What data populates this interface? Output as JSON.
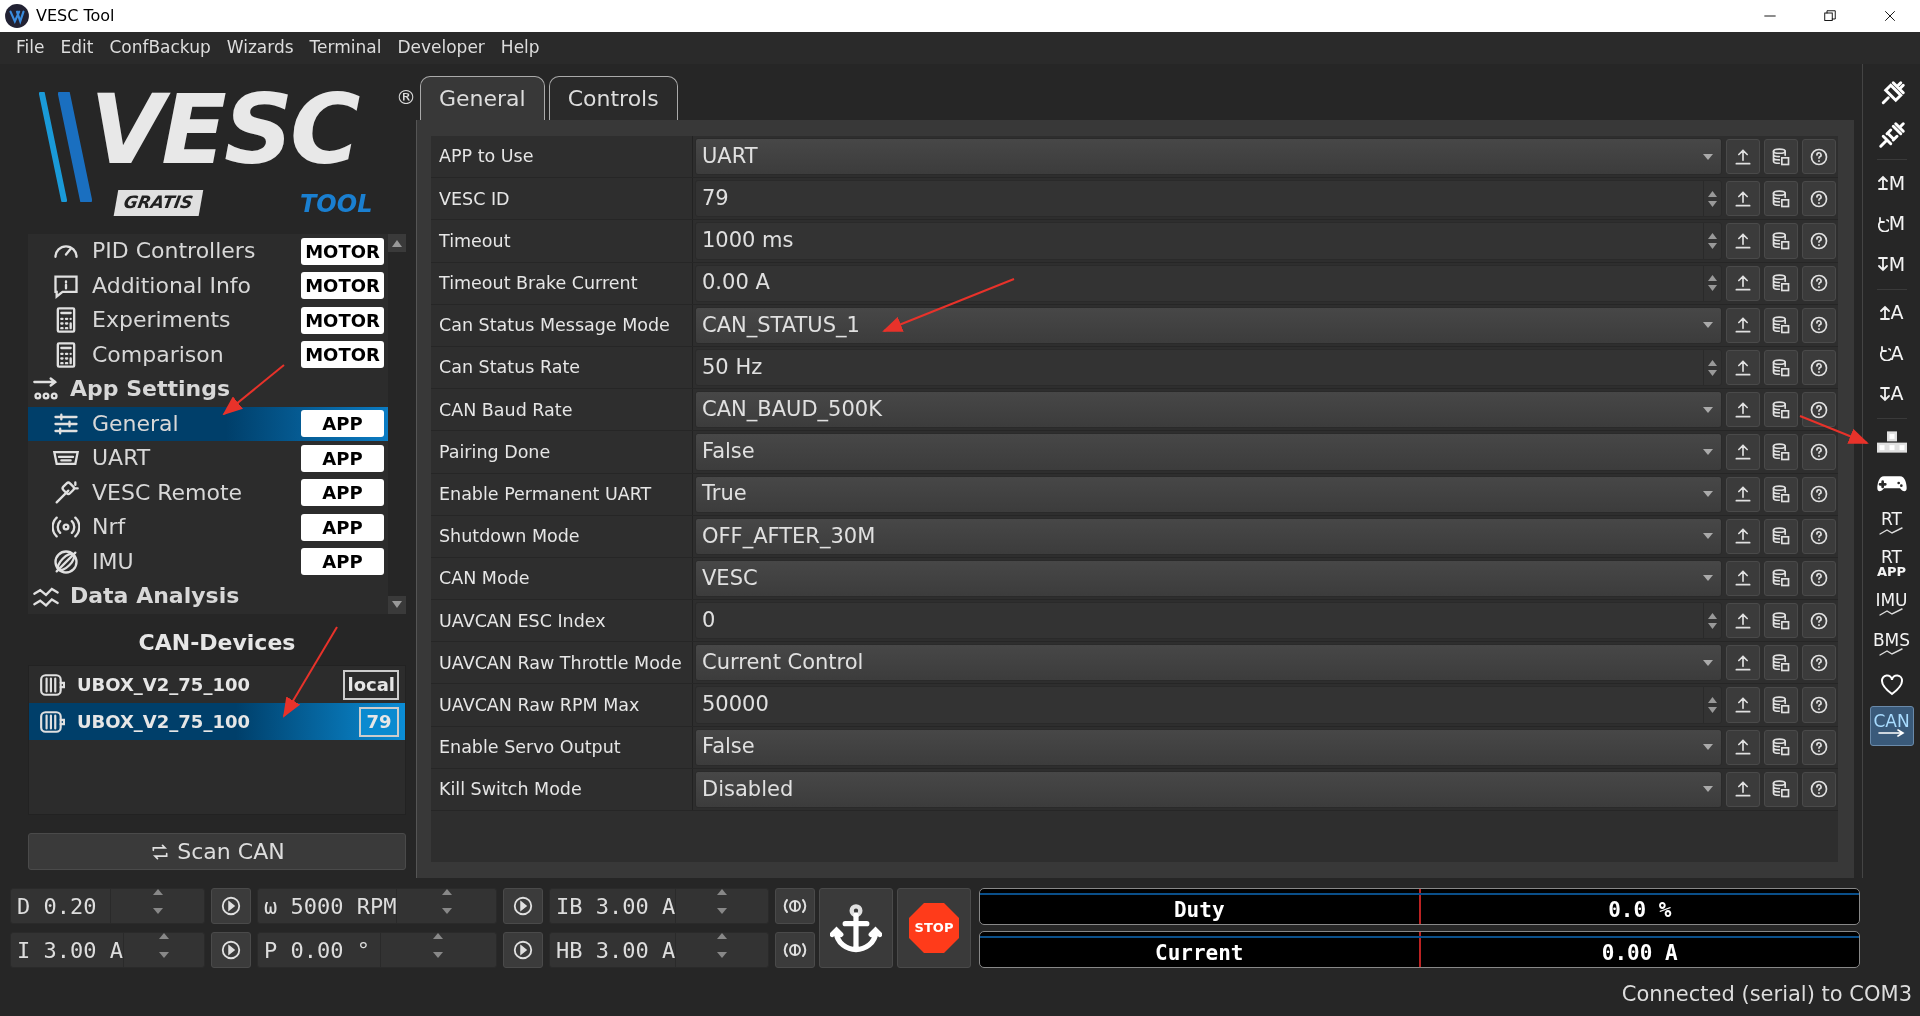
{
  "window": {
    "title": "VESC Tool"
  },
  "menu": [
    "File",
    "Edit",
    "ConfBackup",
    "Wizards",
    "Terminal",
    "Developer",
    "Help"
  ],
  "logo": {
    "wordmark": "VESC",
    "mark": "®",
    "badge": "GRATIS",
    "subtitle": "TOOL"
  },
  "sidebar": {
    "items": [
      {
        "kind": "item",
        "label": "PID Controllers",
        "tag": "MOTOR",
        "selected": false
      },
      {
        "kind": "item",
        "label": "Additional Info",
        "tag": "MOTOR",
        "selected": false
      },
      {
        "kind": "item",
        "label": "Experiments",
        "tag": "MOTOR",
        "selected": false
      },
      {
        "kind": "item",
        "label": "Comparison",
        "tag": "MOTOR",
        "selected": false
      },
      {
        "kind": "header",
        "label": "App Settings",
        "selected": false
      },
      {
        "kind": "item",
        "label": "General",
        "tag": "APP",
        "selected": true
      },
      {
        "kind": "item",
        "label": "UART",
        "tag": "APP",
        "selected": false
      },
      {
        "kind": "item",
        "label": "VESC Remote",
        "tag": "APP",
        "selected": false
      },
      {
        "kind": "item",
        "label": "Nrf",
        "tag": "APP",
        "selected": false
      },
      {
        "kind": "item",
        "label": "IMU",
        "tag": "APP",
        "selected": false
      },
      {
        "kind": "header",
        "label": "Data Analysis",
        "selected": false
      }
    ]
  },
  "can_devices": {
    "title": "CAN-Devices",
    "devices": [
      {
        "name": "UBOX_V2_75_100",
        "id": "local",
        "selected": false
      },
      {
        "name": "UBOX_V2_75_100",
        "id": "79",
        "selected": true
      }
    ],
    "scan_button": "Scan CAN"
  },
  "tabs": [
    {
      "label": "General",
      "selected": true
    },
    {
      "label": "Controls",
      "selected": false
    }
  ],
  "params": [
    {
      "label": "APP to Use",
      "value": "UART",
      "kind": "combo"
    },
    {
      "label": "VESC ID",
      "value": "79",
      "kind": "spin"
    },
    {
      "label": "Timeout",
      "value": "1000 ms",
      "kind": "spin"
    },
    {
      "label": "Timeout Brake Current",
      "value": "0.00 A",
      "kind": "spin"
    },
    {
      "label": "Can Status Message Mode",
      "value": "CAN_STATUS_1",
      "kind": "combo"
    },
    {
      "label": "Can Status Rate",
      "value": "50 Hz",
      "kind": "spin"
    },
    {
      "label": "CAN Baud Rate",
      "value": "CAN_BAUD_500K",
      "kind": "combo"
    },
    {
      "label": "Pairing Done",
      "value": "False",
      "kind": "combo"
    },
    {
      "label": "Enable Permanent UART",
      "value": "True",
      "kind": "combo"
    },
    {
      "label": "Shutdown Mode",
      "value": "OFF_AFTER_30M",
      "kind": "combo"
    },
    {
      "label": "CAN Mode",
      "value": "VESC",
      "kind": "combo"
    },
    {
      "label": "UAVCAN ESC Index",
      "value": "0",
      "kind": "spin"
    },
    {
      "label": "UAVCAN Raw Throttle Mode",
      "value": "Current Control",
      "kind": "combo"
    },
    {
      "label": "UAVCAN Raw RPM Max",
      "value": "50000",
      "kind": "spin"
    },
    {
      "label": "Enable Servo Output",
      "value": "False",
      "kind": "combo"
    },
    {
      "label": "Kill Switch Mode",
      "value": "Disabled",
      "kind": "combo"
    }
  ],
  "toolbar": [
    {
      "kind": "plug",
      "on": false
    },
    {
      "kind": "unplug",
      "on": false
    },
    {
      "kind": "up",
      "label": "M",
      "on": false
    },
    {
      "kind": "reload",
      "label": "M",
      "on": false
    },
    {
      "kind": "down",
      "label": "M",
      "on": false
    },
    {
      "kind": "up",
      "label": "A",
      "on": false
    },
    {
      "kind": "reload",
      "label": "A",
      "on": false
    },
    {
      "kind": "down",
      "label": "A",
      "on": false
    },
    {
      "kind": "blocks",
      "on": false
    },
    {
      "kind": "gamepad",
      "on": false
    },
    {
      "kind": "chart",
      "label": "RT",
      "on": false
    },
    {
      "kind": "chart2",
      "label": "RT",
      "sublabel": "APP",
      "on": false
    },
    {
      "kind": "chart",
      "label": "IMU",
      "on": false
    },
    {
      "kind": "chart",
      "label": "BMS",
      "on": false
    },
    {
      "kind": "heart",
      "on": false
    },
    {
      "kind": "can",
      "label": "CAN",
      "on": true
    }
  ],
  "controls": [
    {
      "value": "D 0.20",
      "kind": "play"
    },
    {
      "value": "ω 5000 RPM",
      "kind": "play"
    },
    {
      "value": "IB 3.00 A",
      "kind": "brake"
    },
    {
      "value": "I 3.00 A",
      "kind": "play"
    },
    {
      "value": "P 0.00 °",
      "kind": "play"
    },
    {
      "value": "HB 3.00 A",
      "kind": "brake"
    }
  ],
  "stop_button": "STOP",
  "gauges": [
    {
      "label": "Duty",
      "reading": "0.0 %"
    },
    {
      "label": "Current",
      "reading": "0.00 A"
    }
  ],
  "status_bar": "Connected (serial) to COM3"
}
